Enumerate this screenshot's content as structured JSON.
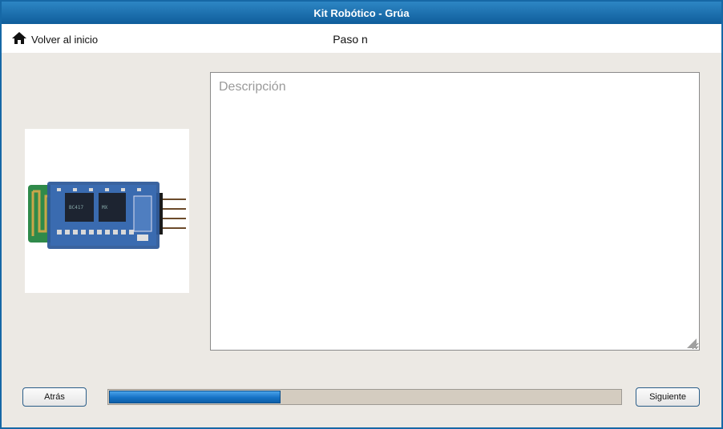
{
  "window": {
    "title": "Kit Robótico - Grúa"
  },
  "nav": {
    "home_label": "Volver al inicio",
    "home_icon": "home-icon",
    "step_title": "Paso n"
  },
  "content": {
    "image_alt": "bluetooth-module",
    "description_placeholder": "Descripción",
    "description_value": ""
  },
  "footer": {
    "back_label": "Atrás",
    "next_label": "Siguiente",
    "progress_fraction": 0.335
  },
  "colors": {
    "titlebar": "#1668a6",
    "progress_fill": "#1672c6",
    "background": "#ece9e4"
  }
}
